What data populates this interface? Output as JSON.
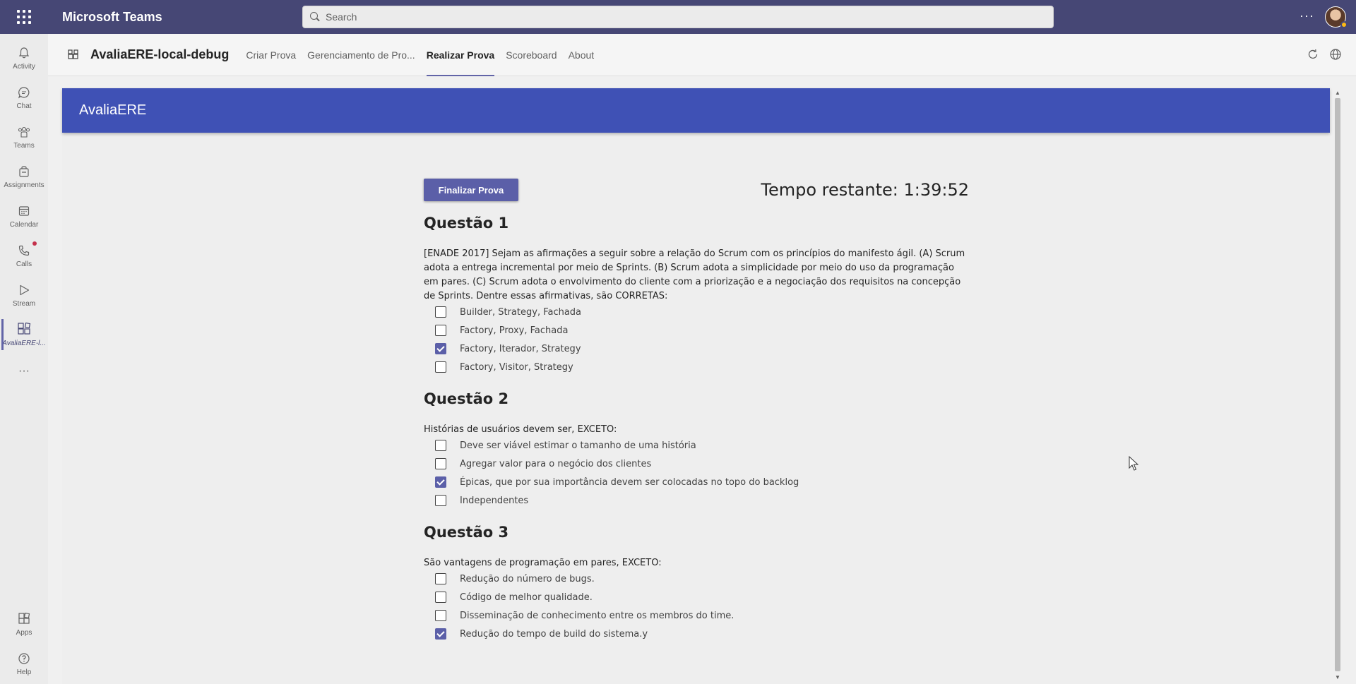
{
  "topbar": {
    "app_name": "Microsoft Teams",
    "search_placeholder": "Search",
    "more_label": "···"
  },
  "rail": {
    "items": [
      {
        "label": "Activity",
        "icon": "bell-icon"
      },
      {
        "label": "Chat",
        "icon": "chat-icon"
      },
      {
        "label": "Teams",
        "icon": "teams-icon"
      },
      {
        "label": "Assignments",
        "icon": "assignments-icon"
      },
      {
        "label": "Calendar",
        "icon": "calendar-icon"
      },
      {
        "label": "Calls",
        "icon": "phone-icon"
      },
      {
        "label": "Stream",
        "icon": "play-icon"
      },
      {
        "label": "AvaliaERE-l...",
        "icon": "app-icon"
      },
      {
        "label": "···",
        "icon": "more-icon"
      },
      {
        "label": "Apps",
        "icon": "apps-icon"
      },
      {
        "label": "Help",
        "icon": "help-icon"
      }
    ]
  },
  "app_header": {
    "title": "AvaliaERE-local-debug",
    "tabs": [
      "Criar Prova",
      "Gerenciamento de Pro...",
      "Realizar Prova",
      "Scoreboard",
      "About"
    ],
    "active_tab": "Realizar Prova"
  },
  "banner": {
    "title": "AvaliaERE"
  },
  "exam": {
    "finish_button": "Finalizar Prova",
    "timer": "Tempo restante: 1:39:52",
    "questions": [
      {
        "title": "Questão 1",
        "text": "[ENADE 2017] Sejam as afirmações a seguir sobre a relação do Scrum com os princípios do manifesto ágil. (A) Scrum adota a entrega incremental por meio de Sprints. (B) Scrum adota a simplicidade por meio do uso da programação em pares. (C) Scrum adota o envolvimento do cliente com a priorização e a negociação dos requisitos na concepção de Sprints. Dentre essas afirmativas, são CORRETAS:",
        "options": [
          {
            "label": "Builder, Strategy, Fachada",
            "checked": false
          },
          {
            "label": "Factory, Proxy, Fachada",
            "checked": false
          },
          {
            "label": "Factory, Iterador, Strategy",
            "checked": true
          },
          {
            "label": "Factory, Visitor, Strategy",
            "checked": false
          }
        ]
      },
      {
        "title": "Questão 2",
        "text": "Histórias de usuários devem ser, EXCETO:",
        "options": [
          {
            "label": "Deve ser viável estimar o tamanho de uma história",
            "checked": false
          },
          {
            "label": "Agregar valor para o negócio dos clientes",
            "checked": false
          },
          {
            "label": "Épicas, que por sua importância devem ser colocadas no topo do backlog",
            "checked": true
          },
          {
            "label": "Independentes",
            "checked": false
          }
        ]
      },
      {
        "title": "Questão 3",
        "text": "São vantagens de programação em pares, EXCETO:",
        "options": [
          {
            "label": "Redução do número de bugs.",
            "checked": false
          },
          {
            "label": "Código de melhor qualidade.",
            "checked": false
          },
          {
            "label": "Disseminação de conhecimento entre os membros do time.",
            "checked": false
          },
          {
            "label": "Redução do tempo de build do sistema.y",
            "checked": true
          }
        ]
      }
    ]
  },
  "colors": {
    "topbar": "#464775",
    "banner": "#3f51b5",
    "accent": "#5b5fa8"
  }
}
